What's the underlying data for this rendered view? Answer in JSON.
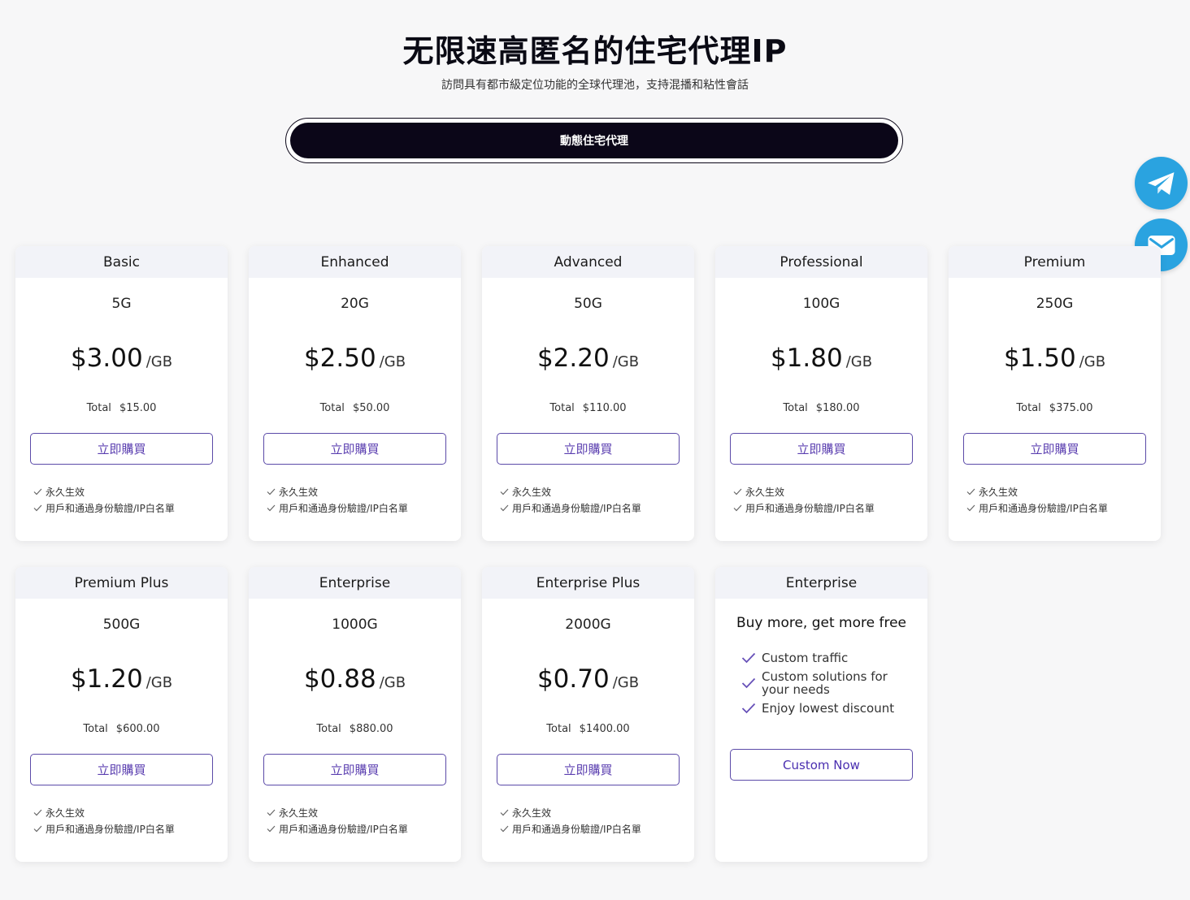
{
  "header": {
    "title": "无限速高匿名的住宅代理IP",
    "subtitle": "訪問具有都市級定位功能的全球代理池，支持混播和粘性會話",
    "tab_label": "動態住宅代理"
  },
  "floating": {
    "telegram_icon": "telegram-icon",
    "mail_icon": "mail-icon",
    "color": "#2aa3e0"
  },
  "common": {
    "unit": "/GB",
    "total_label": "Total",
    "buy_label": "立即購買",
    "features": [
      "永久生效",
      "用戶和通過身份驗證/IP白名單"
    ]
  },
  "plans": [
    {
      "name": "Basic",
      "size": "5G",
      "price": "$3.00",
      "total": "$15.00"
    },
    {
      "name": "Enhanced",
      "size": "20G",
      "price": "$2.50",
      "total": "$50.00"
    },
    {
      "name": "Advanced",
      "size": "50G",
      "price": "$2.20",
      "total": "$110.00"
    },
    {
      "name": "Professional",
      "size": "100G",
      "price": "$1.80",
      "total": "$180.00"
    },
    {
      "name": "Premium",
      "size": "250G",
      "price": "$1.50",
      "total": "$375.00"
    },
    {
      "name": "Premium Plus",
      "size": "500G",
      "price": "$1.20",
      "total": "$600.00"
    },
    {
      "name": "Enterprise",
      "size": "1000G",
      "price": "$0.88",
      "total": "$880.00"
    },
    {
      "name": "Enterprise Plus",
      "size": "2000G",
      "price": "$0.70",
      "total": "$1400.00"
    }
  ],
  "custom_plan": {
    "name": "Enterprise",
    "title": "Buy more, get more free",
    "items": [
      "Custom traffic",
      "Custom solutions for your needs",
      "Enjoy lowest discount"
    ],
    "button_label": "Custom Now"
  },
  "colors": {
    "accent": "#5b3fb0",
    "dark": "#0b0618",
    "card_head": "#f2f3f8"
  }
}
